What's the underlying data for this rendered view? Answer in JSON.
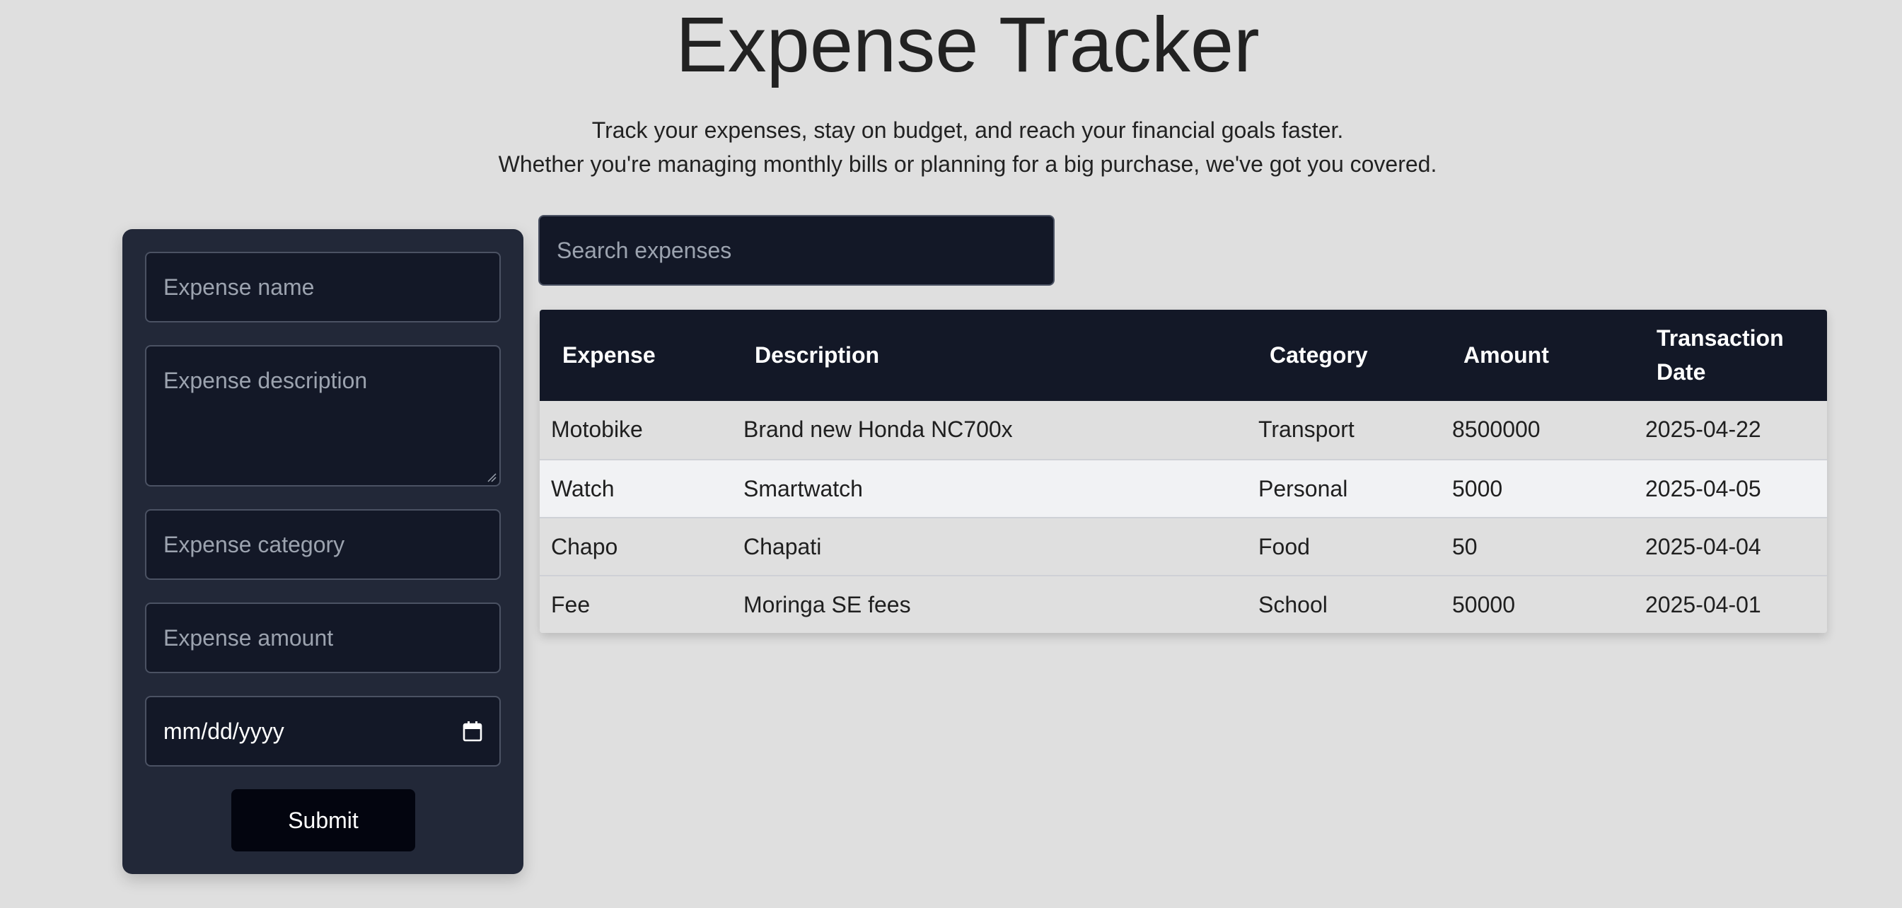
{
  "header": {
    "title": "Expense Tracker",
    "subtitle_line1": "Track your expenses, stay on budget, and reach your financial goals faster.",
    "subtitle_line2": "Whether you're managing monthly bills or planning for a big purchase, we've got you covered."
  },
  "form": {
    "name_placeholder": "Expense name",
    "description_placeholder": "Expense description",
    "category_placeholder": "Expense category",
    "amount_placeholder": "Expense amount",
    "date_placeholder": "mm/dd/yyyy",
    "submit_label": "Submit",
    "date_icon": "calendar-icon"
  },
  "search": {
    "placeholder": "Search expenses"
  },
  "table": {
    "headers": {
      "expense": "Expense",
      "description": "Description",
      "category": "Category",
      "amount": "Amount",
      "date_line1": "Transaction",
      "date_line2": "Date"
    },
    "rows": [
      {
        "expense": "Motobike",
        "description": "Brand new Honda NC700x",
        "category": "Transport",
        "amount": "8500000",
        "date": "2025-04-22"
      },
      {
        "expense": "Watch",
        "description": "Smartwatch",
        "category": "Personal",
        "amount": "5000",
        "date": "2025-04-05"
      },
      {
        "expense": "Chapo",
        "description": "Chapati",
        "category": "Food",
        "amount": "50",
        "date": "2025-04-04"
      },
      {
        "expense": "Fee",
        "description": "Moringa SE fees",
        "category": "School",
        "amount": "50000",
        "date": "2025-04-01"
      }
    ]
  },
  "colors": {
    "background": "#dfdfdf",
    "panel": "#222838",
    "input": "#131827",
    "table_header": "#131827",
    "highlight_row": "#f1f2f4",
    "button": "#03050f"
  }
}
